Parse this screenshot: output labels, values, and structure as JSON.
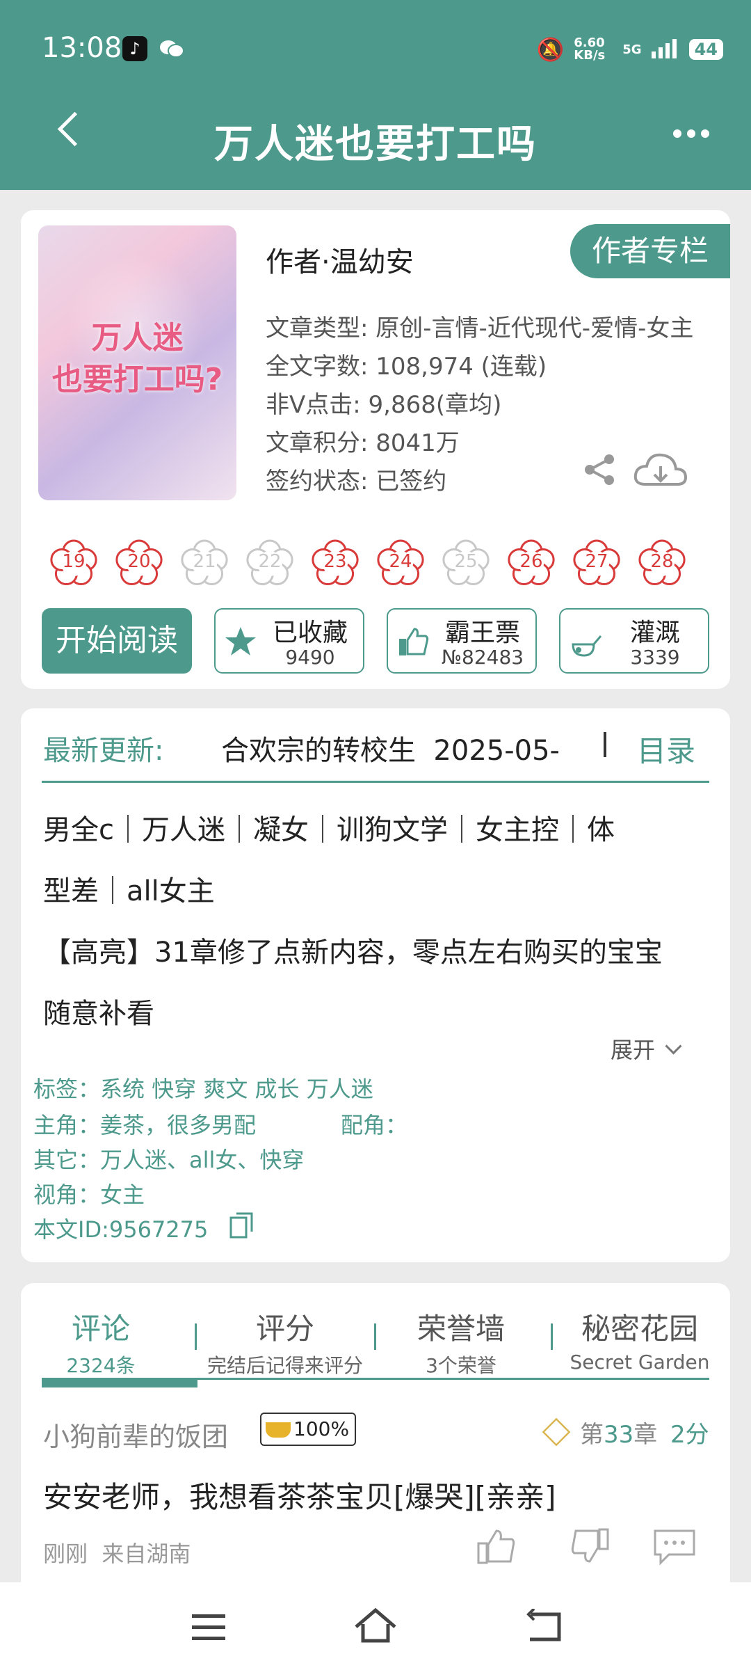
{
  "status": {
    "time": "13:08",
    "speed": "6.60 KB/s",
    "network": "5G",
    "battery": "44"
  },
  "header": {
    "title": "万人迷也要打工吗"
  },
  "book": {
    "cover_text": [
      "万人迷",
      "也要打工吗?"
    ],
    "author": "作者·温幼安",
    "column_button": "作者专栏",
    "info": [
      "文章类型: 原创-言情-近代现代-爱情-女主",
      "全文字数: 108,974 (连载)",
      "非V点击: 9,868(章均)",
      "文章积分: 8041万",
      "签约状态: 已签约"
    ],
    "flowers": [
      {
        "num": "19",
        "active": true
      },
      {
        "num": "20",
        "active": true
      },
      {
        "num": "21",
        "active": false
      },
      {
        "num": "22",
        "active": false
      },
      {
        "num": "23",
        "active": true
      },
      {
        "num": "24",
        "active": true
      },
      {
        "num": "25",
        "active": false
      },
      {
        "num": "26",
        "active": true
      },
      {
        "num": "27",
        "active": true
      },
      {
        "num": "28",
        "active": true
      }
    ],
    "read_button": "开始阅读",
    "collect": {
      "label": "已收藏",
      "count": "9490"
    },
    "ticket": {
      "label": "霸王票",
      "count": "№82483"
    },
    "irrigate": {
      "label": "灌溉",
      "count": "3339"
    }
  },
  "detail": {
    "latest_label": "最新更新:",
    "latest_title": "合欢宗的转校生  2025-05-",
    "catalog": "目录",
    "keywords_line1": "男全c｜万人迷｜凝女｜训狗文学｜女主控｜体",
    "keywords_line2": "型差｜all女主",
    "notice_line1": "【高亮】31章修了点新内容，零点左右购买的宝宝",
    "notice_line2": "随意补看",
    "expand": "展开",
    "tags": "标签：系统 快穿 爽文 成长 万人迷",
    "lead": "主角：姜茶，很多男配",
    "supporting": "配角：",
    "other": "其它：万人迷、all女、快穿",
    "pov": "视角：女主",
    "book_id": "本文ID:9567275"
  },
  "tabs": [
    {
      "title": "评论",
      "sub": "2324条"
    },
    {
      "title": "评分",
      "sub": "完结后记得来评分"
    },
    {
      "title": "荣誉墙",
      "sub": "3个荣誉"
    },
    {
      "title": "秘密花园",
      "sub": "Secret Garden"
    }
  ],
  "comment": {
    "user": "小狗前辈的饭团",
    "badge": "100%",
    "chapter_prefix": "第",
    "chapter_num": "33",
    "chapter_suffix": "章",
    "score": "2分",
    "text": "安安老师，我想看茶茶宝贝[爆哭][亲亲]",
    "meta": "刚刚  来自湖南"
  },
  "colors": {
    "accent": "#4d9a8c",
    "flower_red": "#d93a3a",
    "flower_gray": "#c8c8c8"
  }
}
